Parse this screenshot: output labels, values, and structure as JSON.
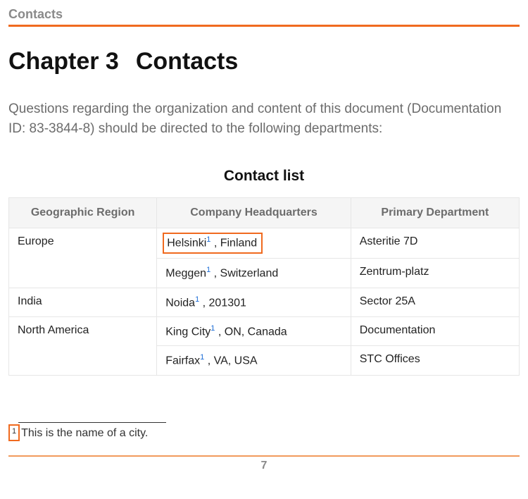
{
  "runningHead": "Contacts",
  "chapterLabel": "Chapter 3",
  "chapterTitle": "Contacts",
  "intro": "Questions regarding the organization and content of this document (Documentation ID: 83-3844-8) should be directed to the following departments:",
  "tableCaption": "Contact list",
  "columns": {
    "region": "Geographic Region",
    "hq": "Company Headquarters",
    "dept": "Primary Department"
  },
  "fnRef": "1",
  "rows": {
    "r0": {
      "region": "Europe",
      "city": "Helsinki",
      "rest": " , Finland",
      "dept": "Asteritie 7D"
    },
    "r1": {
      "region": "",
      "city": "Meggen",
      "rest": " , Switzerland",
      "dept": "Zentrum-platz"
    },
    "r2": {
      "region": "India",
      "city": "Noida",
      "rest": " , 201301",
      "dept": "Sector 25A"
    },
    "r3": {
      "region": "North America",
      "city": "King City",
      "rest": " , ON, Canada",
      "dept": "Documentation"
    },
    "r4": {
      "region": "",
      "city": "Fairfax",
      "rest": " , VA, USA",
      "dept": "STC Offices"
    }
  },
  "footnote": {
    "marker": "1",
    "text": "This is the name of a city."
  },
  "pageNumber": "7"
}
